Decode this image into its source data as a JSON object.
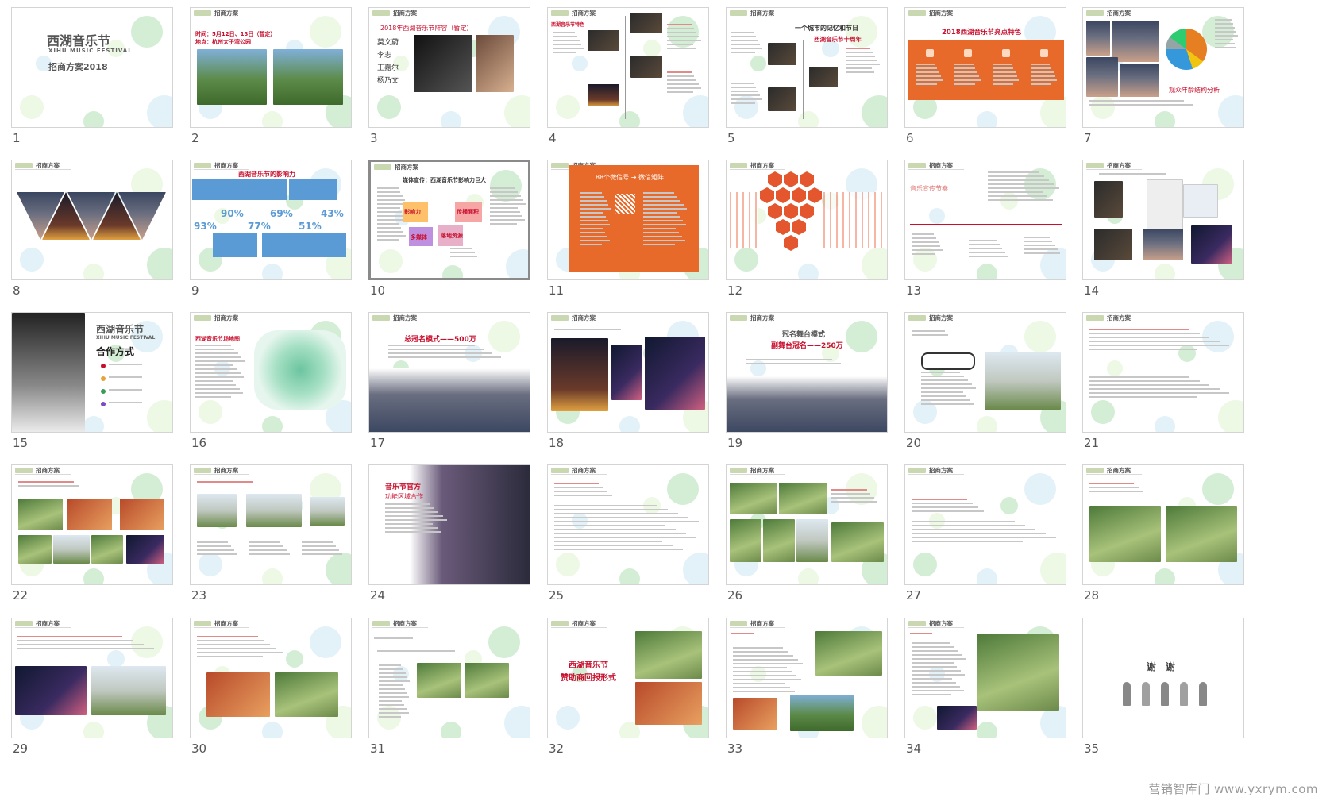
{
  "header_label": "招商方案",
  "watermark": "营销智库门 www.yxrym.com",
  "selected_slide": 10,
  "slides": [
    {
      "num": "1",
      "title": "西湖音乐节",
      "subtitle": "XIHU MUSIC FESTIVAL",
      "text": "招商方案2018"
    },
    {
      "num": "2",
      "title": "时间：5月12日、13日（暂定）",
      "subtitle": "地点：杭州太子湾公园",
      "text": ""
    },
    {
      "num": "3",
      "title": "2018年西湖音乐节阵容（暂定）",
      "subtitle": "",
      "text": "",
      "list": [
        "莫文蔚",
        "李志",
        "王嘉尔",
        "杨乃文"
      ]
    },
    {
      "num": "4",
      "title": "西湖音乐节特色",
      "subtitle": "",
      "text": ""
    },
    {
      "num": "5",
      "title": "一个城市的记忆和节日",
      "subtitle": "西湖音乐节十周年",
      "text": ""
    },
    {
      "num": "6",
      "title": "2018西湖音乐节亮点特色",
      "subtitle": "",
      "text": ""
    },
    {
      "num": "7",
      "title": "观众年龄结构分析",
      "subtitle": "",
      "text": ""
    },
    {
      "num": "8",
      "title": "",
      "subtitle": "",
      "text": ""
    },
    {
      "num": "9",
      "title": "西湖音乐节的影响力",
      "subtitle": "",
      "text": "",
      "stats": [
        "90%",
        "69%",
        "43%",
        "93%",
        "77%",
        "51%"
      ]
    },
    {
      "num": "10",
      "title": "媒体宣传：西湖音乐节影响力巨大",
      "subtitle": "",
      "text": "",
      "chips": [
        "影响力",
        "传播面积",
        "多媒体",
        "落地资源"
      ]
    },
    {
      "num": "11",
      "title": "88个微信号 → 微信矩阵",
      "subtitle": "",
      "text": ""
    },
    {
      "num": "12",
      "title": "",
      "subtitle": "",
      "text": ""
    },
    {
      "num": "13",
      "title": "音乐宣传节奏",
      "subtitle": "",
      "text": ""
    },
    {
      "num": "14",
      "title": "",
      "subtitle": "",
      "text": ""
    },
    {
      "num": "15",
      "title": "西湖音乐节",
      "subtitle": "XIHU MUSIC FESTIVAL",
      "text": "合作方式"
    },
    {
      "num": "16",
      "title": "西湖音乐节场地图",
      "subtitle": "",
      "text": ""
    },
    {
      "num": "17",
      "title": "总冠名模式——500万",
      "subtitle": "",
      "text": ""
    },
    {
      "num": "18",
      "title": "",
      "subtitle": "",
      "text": ""
    },
    {
      "num": "19",
      "title": "冠名舞台模式",
      "subtitle": "副舞台冠名——250万",
      "text": ""
    },
    {
      "num": "20",
      "title": "",
      "subtitle": "",
      "text": ""
    },
    {
      "num": "21",
      "title": "",
      "subtitle": "",
      "text": ""
    },
    {
      "num": "22",
      "title": "",
      "subtitle": "",
      "text": ""
    },
    {
      "num": "23",
      "title": "",
      "subtitle": "",
      "text": ""
    },
    {
      "num": "24",
      "title": "音乐节官方",
      "subtitle": "功能区域合作",
      "text": ""
    },
    {
      "num": "25",
      "title": "",
      "subtitle": "",
      "text": ""
    },
    {
      "num": "26",
      "title": "",
      "subtitle": "",
      "text": ""
    },
    {
      "num": "27",
      "title": "",
      "subtitle": "",
      "text": ""
    },
    {
      "num": "28",
      "title": "",
      "subtitle": "",
      "text": ""
    },
    {
      "num": "29",
      "title": "",
      "subtitle": "",
      "text": ""
    },
    {
      "num": "30",
      "title": "",
      "subtitle": "",
      "text": ""
    },
    {
      "num": "31",
      "title": "",
      "subtitle": "",
      "text": ""
    },
    {
      "num": "32",
      "title": "西湖音乐节",
      "subtitle": "赞助商回报形式",
      "text": ""
    },
    {
      "num": "33",
      "title": "",
      "subtitle": "",
      "text": ""
    },
    {
      "num": "34",
      "title": "",
      "subtitle": "",
      "text": ""
    },
    {
      "num": "35",
      "title": "谢　谢",
      "subtitle": "",
      "text": ""
    }
  ]
}
